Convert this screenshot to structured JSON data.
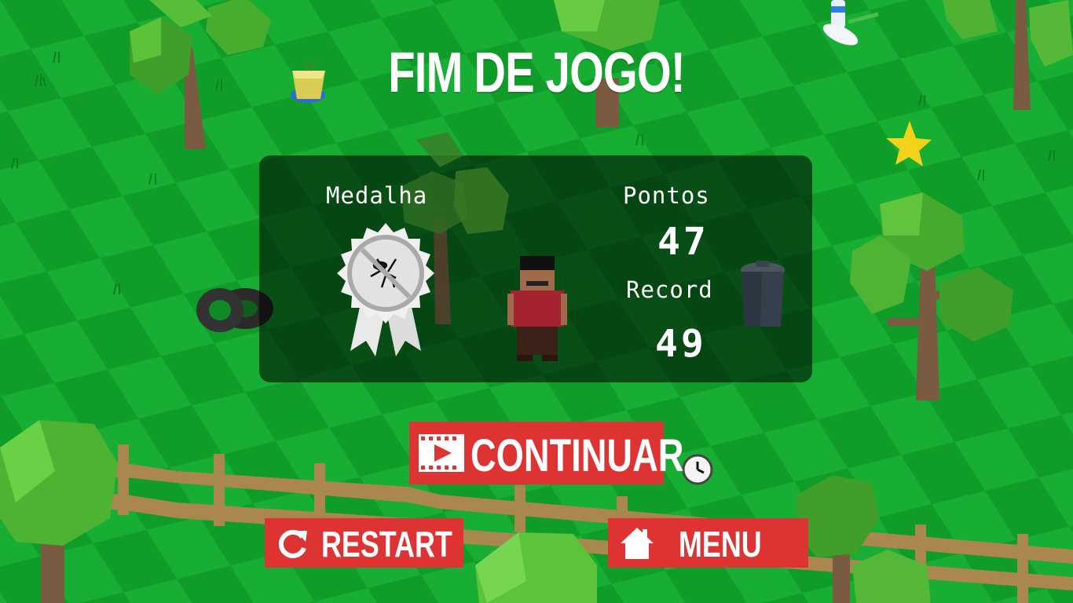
{
  "header": {
    "title": "FIM DE JOGO!"
  },
  "results": {
    "medal_label": "Medalha",
    "points_label": "Pontos",
    "points_value": "47",
    "record_label": "Record",
    "record_value": "49"
  },
  "buttons": {
    "continue_label": "CONTINUAR",
    "restart_label": "RESTART",
    "menu_label": "MENU"
  },
  "colors": {
    "grass_light": "#1cb53a",
    "grass_dark": "#13a22b",
    "button_red": "#dd3333",
    "panel_overlay": "rgba(0,0,0,0.55)"
  },
  "icons": {
    "continue": "video-play-icon",
    "restart": "restart-icon",
    "menu": "home-icon",
    "medal": "no-mosquito-medal-icon"
  }
}
